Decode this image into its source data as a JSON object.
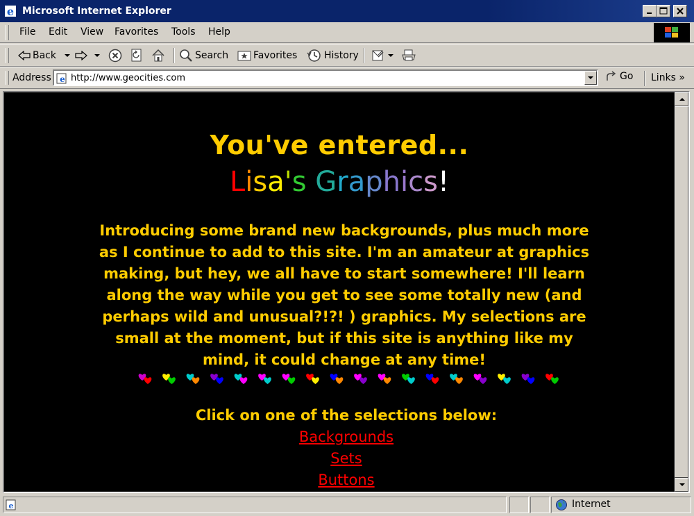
{
  "window": {
    "title": "Microsoft Internet Explorer"
  },
  "menu": [
    "File",
    "Edit",
    "View",
    "Favorites",
    "Tools",
    "Help"
  ],
  "toolbar": {
    "back": "Back",
    "search": "Search",
    "favorites": "Favorites",
    "history": "History"
  },
  "address": {
    "label": "Address",
    "url": "http://www.geocities.com",
    "go": "Go",
    "links": "Links"
  },
  "page": {
    "heading": "You've entered...",
    "site_name_letters": [
      {
        "ch": "L",
        "color": "#ff0000"
      },
      {
        "ch": "i",
        "color": "#ff8800"
      },
      {
        "ch": "s",
        "color": "#ffcc00"
      },
      {
        "ch": "a",
        "color": "#ffee00"
      },
      {
        "ch": "'",
        "color": "#bbdd00"
      },
      {
        "ch": "s",
        "color": "#33cc33"
      },
      {
        "ch": " ",
        "color": "#000000"
      },
      {
        "ch": "G",
        "color": "#22aa99"
      },
      {
        "ch": "r",
        "color": "#22aacc"
      },
      {
        "ch": "a",
        "color": "#3399cc"
      },
      {
        "ch": "p",
        "color": "#6688cc"
      },
      {
        "ch": "h",
        "color": "#8877cc"
      },
      {
        "ch": "i",
        "color": "#9977cc"
      },
      {
        "ch": "c",
        "color": "#aa88cc"
      },
      {
        "ch": "s",
        "color": "#cc99cc"
      },
      {
        "ch": "!",
        "color": "#ffffff"
      }
    ],
    "intro": "Introducing some brand new backgrounds, plus much more as I continue to add to this site. I'm an amateur at graphics making, but hey, we all have to start somewhere! I'll learn along the way while you get to see some totally new (and perhaps wild and unusual?!?! ) graphics. My selections are small at the moment, but if this site is anything like my mind, it could change at any time!",
    "hearts": [
      [
        "#cc00cc",
        "#ff0000"
      ],
      [
        "#ffee00",
        "#00cc00"
      ],
      [
        "#00cccc",
        "#ff8800"
      ],
      [
        "#8800cc",
        "#0000ff"
      ],
      [
        "#00cccc",
        "#ff00ff"
      ],
      [
        "#ff00ff",
        "#00cccc"
      ],
      [
        "#ff00ff",
        "#00cc00"
      ],
      [
        "#ff0000",
        "#ffee00"
      ],
      [
        "#0000ff",
        "#ff8800"
      ],
      [
        "#ff00ff",
        "#8800cc"
      ],
      [
        "#ff00ff",
        "#ff8800"
      ],
      [
        "#00cc00",
        "#00cccc"
      ],
      [
        "#0000ff",
        "#ff0000"
      ],
      [
        "#00cccc",
        "#ff8800"
      ],
      [
        "#ff00ff",
        "#8800cc"
      ],
      [
        "#ffee00",
        "#00cccc"
      ],
      [
        "#8800cc",
        "#0000ff"
      ],
      [
        "#ff0000",
        "#00cc00"
      ]
    ],
    "click_text": "Click on one of the selections below:",
    "links": [
      "Backgrounds",
      "Sets",
      "Buttons"
    ]
  },
  "status": {
    "zone": "Internet"
  }
}
